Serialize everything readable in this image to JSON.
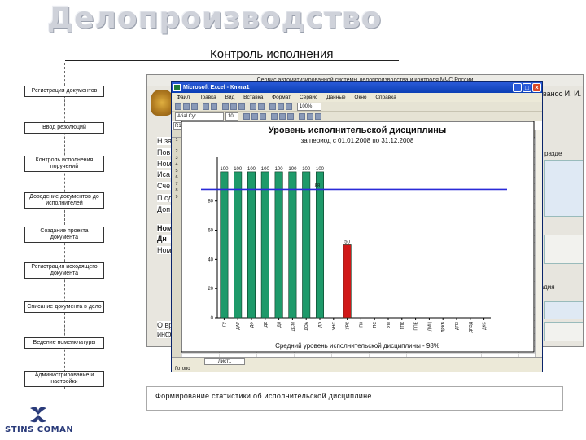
{
  "slide": {
    "title": "Делопроизводство",
    "subtitle": "Контроль исполнения",
    "caption": "Формирование статистики об исполнительской дисциплине …",
    "logo_text": "STINS COMAN"
  },
  "flow_steps": [
    "Регистрация документов",
    "Ввод резолюций",
    "Контроль исполнения поручений",
    "Доведение документов до исполнителей",
    "Создание проекта документа",
    "Регистрация исходящего документа",
    "Списание документа в дело",
    "Ведение номенклатуры",
    "Администрирование и настройки"
  ],
  "app": {
    "banner": "Сервис автоматизированной системы делопроизводства и контроля МЧС России",
    "user_label": "ванос И. И.",
    "left_items": [
      "Н.за",
      "Пов",
      "Ном",
      "Иса",
      "Сче",
      "П.сд",
      "Доп",
      "Ном",
      "Дн",
      "Ном",
      "О вр",
      "инф"
    ],
    "right_items": [
      "разде",
      "ладия"
    ]
  },
  "excel": {
    "title": "Microsoft Excel - Книга1",
    "menu": [
      "Файл",
      "Правка",
      "Вид",
      "Вставка",
      "Формат",
      "Сервис",
      "Данные",
      "Окно",
      "Справка"
    ],
    "font_name": "Arial Cyr",
    "zoom": "100%",
    "font_size": "10",
    "namebox": "R1C1",
    "sheet_tab": "Лист1",
    "status": "Готово",
    "formula_value": "",
    "colors": {
      "bar_green": "#1e9a6a",
      "bar_red": "#d01818",
      "avg_line": "#2a2ad8"
    }
  },
  "chart_data": {
    "type": "bar",
    "title": "Уровень исполнительской дисциплины",
    "subtitle": "за период с 01.01.2008 по 31.12.2008",
    "footer": "Средний уровень исполнительской дисциплины - 98%",
    "categories": [
      "ГУ",
      "ДАУ",
      "ДФ",
      "ДК",
      "ДЛ",
      "ДСМ",
      "ДОА",
      "ДЭ",
      "УНС",
      "УРК",
      "ПЗ",
      "ПС",
      "УМ",
      "ГПК",
      "ППЕ",
      "ДМЦ",
      "ДРКВ",
      "ДПЗ",
      "ДПЗД",
      "ДКС"
    ],
    "values": [
      100,
      100,
      100,
      100,
      100,
      100,
      100,
      100,
      null,
      50,
      null,
      null,
      null,
      null,
      null,
      null,
      null,
      null,
      null,
      null
    ],
    "data_labels": [
      "100",
      "100",
      "100",
      "100",
      "100",
      "100",
      "100",
      "100",
      "",
      "50"
    ],
    "bar_colors": [
      "green",
      "green",
      "green",
      "green",
      "green",
      "green",
      "green",
      "green",
      "",
      "red"
    ],
    "average": 88,
    "average_label": "88",
    "yticks": [
      0,
      20,
      40,
      60,
      80
    ],
    "ylim": [
      0,
      110
    ],
    "grid": false,
    "legend": "none"
  }
}
